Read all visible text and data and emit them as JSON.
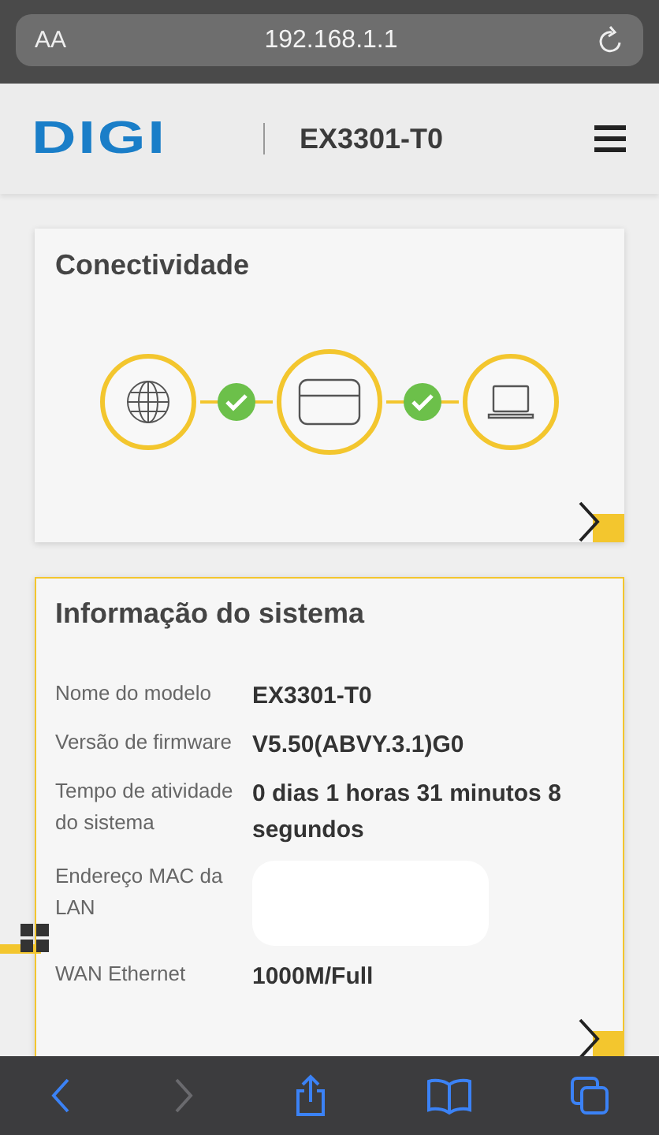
{
  "browser": {
    "text_size_button": "AA",
    "url": "192.168.1.1"
  },
  "header": {
    "logo": "DIGI",
    "model": "EX3301-T0"
  },
  "connectivity": {
    "title": "Conectividade",
    "focused": false,
    "nodes": [
      {
        "kind": "globe"
      },
      {
        "kind": "router"
      },
      {
        "kind": "laptop"
      }
    ],
    "links": [
      {
        "connected": true
      },
      {
        "connected": true
      }
    ]
  },
  "system_info": {
    "title": "Informação do sistema",
    "focused": true,
    "rows": [
      {
        "label": "Nome do modelo",
        "value": "EX3301-T0"
      },
      {
        "label": "Versão de firmware",
        "value": "V5.50(ABVY.3.1)G0"
      },
      {
        "label": "Tempo de atividade do sistema",
        "value": "0 dias 1 horas 31 minutos 8 segundos"
      },
      {
        "label": "Endereço MAC da LAN",
        "redacted": true
      },
      {
        "label": "WAN Ethernet",
        "value": "1000M/Full"
      }
    ]
  },
  "toolbar": [
    {
      "kind": "back",
      "disabled": false
    },
    {
      "kind": "forward",
      "disabled": true
    },
    {
      "kind": "share",
      "disabled": false
    },
    {
      "kind": "bookmarks",
      "disabled": false
    },
    {
      "kind": "tabs",
      "disabled": false
    }
  ]
}
